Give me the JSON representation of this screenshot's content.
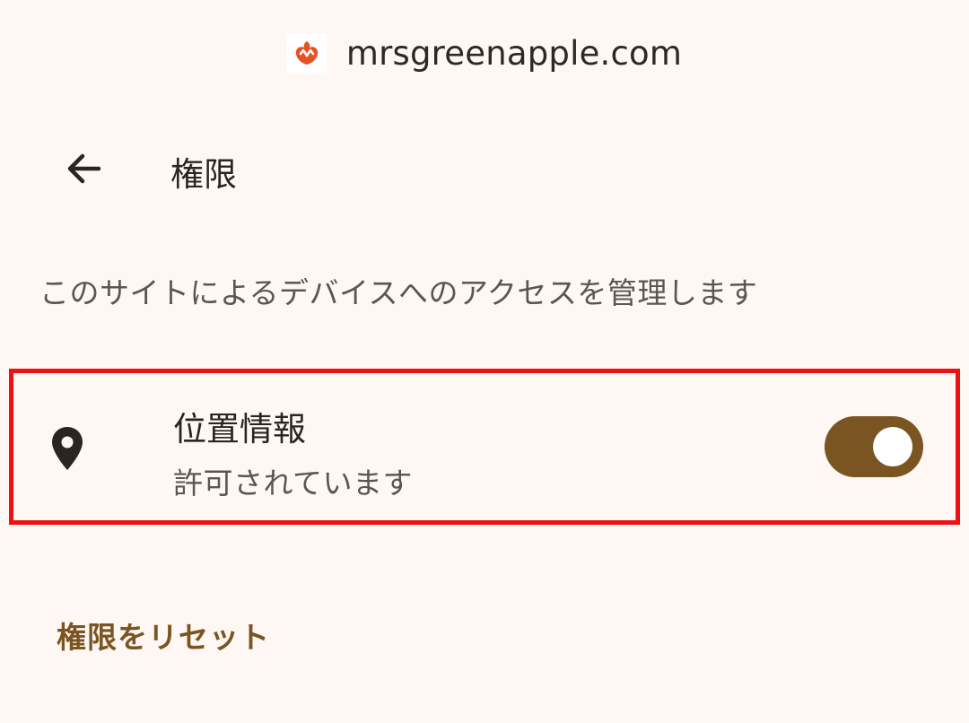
{
  "site": {
    "domain": "mrsgreenapple.com",
    "favicon": "mrs-green-apple-logo-icon",
    "favicon_color": "#e65322"
  },
  "app_bar": {
    "back_icon": "arrow-left-icon",
    "title": "権限"
  },
  "description": "このサイトによるデバイスへのアクセスを管理します",
  "permissions": [
    {
      "icon": "location-pin-icon",
      "title": "位置情報",
      "status": "許可されています",
      "enabled": true
    }
  ],
  "reset_label": "権限をリセット",
  "colors": {
    "background": "#fff7f3",
    "accent": "#7a5522",
    "highlight_border": "#ee1111"
  }
}
